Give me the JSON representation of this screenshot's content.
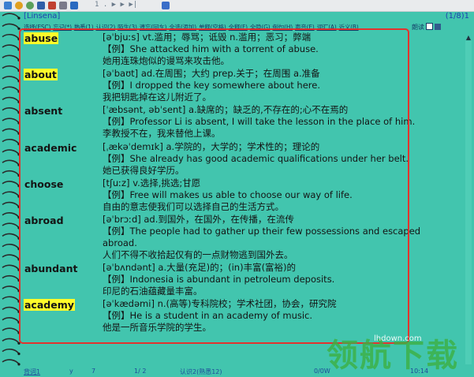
{
  "toolbar": {
    "nav_text": "1 . ▶ ▶ ▶|",
    "icons": [
      "open-icon",
      "refresh-icon",
      "settings-icon",
      "book-icon",
      "edit-icon",
      "tools-icon",
      "play-icon",
      "next-icon",
      "last-icon",
      "export-icon"
    ]
  },
  "header": {
    "brand": "[Linsena]",
    "page_count": "(1/8)1",
    "filter_items": [
      "选择(ESC)",
      "忘记(*)",
      "熟悉(1)",
      "认识(2)",
      "陌生(3)",
      "遗忘(回车)",
      "全选(添加)",
      "单释(空格)",
      "全释(F)",
      "全隐(G)",
      "例句(H)",
      "声音(E)",
      "词汇(A)",
      "近义(B)"
    ],
    "read_label": "朗读"
  },
  "entries": [
    {
      "word": "abuse",
      "highlight": true,
      "defn": "[əˈbjuːs] vt.滥用；辱骂；诋毁 n.滥用；恶习；弊端",
      "example": "【例】She attacked him with a torrent of abuse.",
      "translation": "她用连珠炮似的谩骂来攻击他。"
    },
    {
      "word": "about",
      "highlight": true,
      "defn": "[əˈbaʊt] ad.在周围；大约 prep.关于；在周围 a.准备",
      "example": "【例】I dropped the key somewhere about here.",
      "translation": "我把钥匙掉在这儿附近了。"
    },
    {
      "word": "absent",
      "highlight": false,
      "defn": "[ˈæbsənt, əbˈsent] a.缺席的；缺乏的,不存在的;心不在焉的",
      "example": "【例】Professor Li is absent, I will take the lesson in the place of him.",
      "translation": "李教授不在，我来替他上课。"
    },
    {
      "word": "academic",
      "highlight": false,
      "defn": "[ˌækəˈdemɪk] a.学院的，大学的；学术性的；理论的",
      "example": "【例】She already has good academic qualifications under her belt.",
      "translation": "她已获得良好学历。"
    },
    {
      "word": "choose",
      "highlight": false,
      "defn": "[tʃuːz] v.选择,挑选;甘愿",
      "example": "【例】Free will makes us able to choose our way of life.",
      "translation": "自由的意志使我们可以选择自己的生活方式。"
    },
    {
      "word": "abroad",
      "highlight": false,
      "defn": "[əˈbrɔːd] ad.到国外，在国外，在传播，在流传",
      "example": "【例】The people had to gather up their few possessions and escaped",
      "example_cont": "abroad.",
      "translation": "人们不得不收拾起仅有的一点财物逃到国外去。"
    },
    {
      "word": "abundant",
      "highlight": false,
      "defn": "[əˈbʌndənt] a.大量(充足)的；(in)丰富(富裕)的",
      "example": "【例】Indonesia is abundant in petroleum deposits.",
      "translation": "印尼的石油蕴藏量丰富。"
    },
    {
      "word": "academy",
      "highlight": true,
      "defn": "[əˈkædəmi] n.(高等)专科院校；学术社团，协会，研究院",
      "example": "【例】He is a student in an academy of music.",
      "translation": "他是一所音乐学院的学生。"
    }
  ],
  "status": {
    "left": "背词1",
    "mid1": "y",
    "mid2": "7",
    "mid3": "1/ 2",
    "mid4": "认识2(熟悉12)",
    "mid5": "0/0W",
    "time": "10:14"
  },
  "watermark": {
    "cn": "领航下载",
    "url": "lhdown.com"
  },
  "colors": {
    "bg": "#42c5ae",
    "highlight": "#fffb2a",
    "frame": "#e2332e",
    "link": "#1e3fb0"
  }
}
